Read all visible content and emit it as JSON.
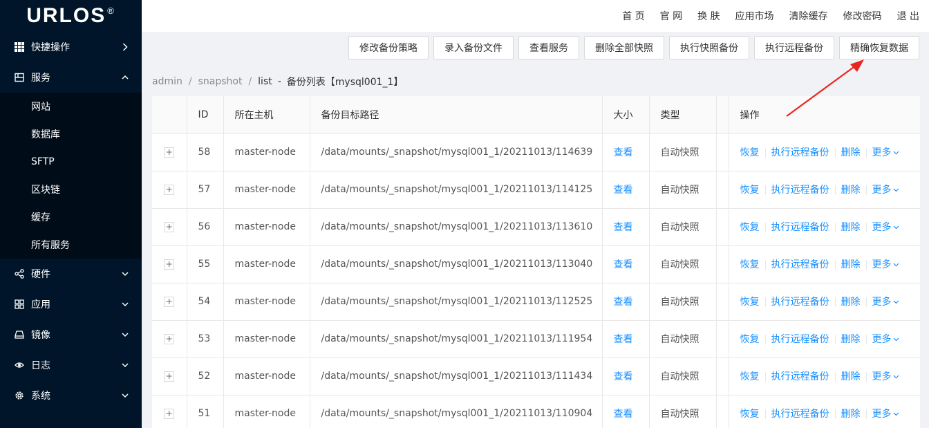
{
  "logo": {
    "text": "URLOS",
    "mark": "®"
  },
  "sidebar": {
    "quick": {
      "label": "快捷操作",
      "icon": "grid-icon"
    },
    "services": {
      "label": "服务",
      "icon": "server-icon",
      "items": [
        "网站",
        "数据库",
        "SFTP",
        "区块链",
        "缓存",
        "所有服务"
      ]
    },
    "bottom": [
      {
        "label": "硬件",
        "icon": "share-icon"
      },
      {
        "label": "应用",
        "icon": "apps-icon"
      },
      {
        "label": "镜像",
        "icon": "drive-icon"
      },
      {
        "label": "日志",
        "icon": "eye-icon"
      },
      {
        "label": "系统",
        "icon": "gear-icon"
      }
    ]
  },
  "header": {
    "links": [
      "首 页",
      "官 网",
      "换 肤",
      "应用市场",
      "清除缓存",
      "修改密码",
      "退 出"
    ]
  },
  "toolbar": {
    "buttons": [
      "修改备份策略",
      "录入备份文件",
      "查看服务",
      "删除全部快照",
      "执行快照备份",
      "执行远程备份",
      "精确恢复数据"
    ]
  },
  "breadcrumb": {
    "parts": [
      "admin",
      "snapshot",
      "list"
    ],
    "dash": "-",
    "current": "备份列表【mysql001_1】"
  },
  "table": {
    "headers": {
      "id": "ID",
      "host": "所在主机",
      "path": "备份目标路径",
      "size": "大小",
      "type": "类型",
      "op": "操作"
    },
    "expand_label": "+",
    "ops": {
      "restore": "恢复",
      "remote": "执行远程备份",
      "delete": "删除",
      "more": "更多"
    },
    "rows": [
      {
        "id": "58",
        "host": "master-node",
        "path": "/data/mounts/_snapshot/mysql001_1/20211013/114639",
        "size": "查看",
        "type": "自动快照"
      },
      {
        "id": "57",
        "host": "master-node",
        "path": "/data/mounts/_snapshot/mysql001_1/20211013/114125",
        "size": "查看",
        "type": "自动快照"
      },
      {
        "id": "56",
        "host": "master-node",
        "path": "/data/mounts/_snapshot/mysql001_1/20211013/113610",
        "size": "查看",
        "type": "自动快照"
      },
      {
        "id": "55",
        "host": "master-node",
        "path": "/data/mounts/_snapshot/mysql001_1/20211013/113040",
        "size": "查看",
        "type": "自动快照"
      },
      {
        "id": "54",
        "host": "master-node",
        "path": "/data/mounts/_snapshot/mysql001_1/20211013/112525",
        "size": "查看",
        "type": "自动快照"
      },
      {
        "id": "53",
        "host": "master-node",
        "path": "/data/mounts/_snapshot/mysql001_1/20211013/111954",
        "size": "查看",
        "type": "自动快照"
      },
      {
        "id": "52",
        "host": "master-node",
        "path": "/data/mounts/_snapshot/mysql001_1/20211013/111434",
        "size": "查看",
        "type": "自动快照"
      },
      {
        "id": "51",
        "host": "master-node",
        "path": "/data/mounts/_snapshot/mysql001_1/20211013/110904",
        "size": "查看",
        "type": "自动快照"
      }
    ]
  },
  "colors": {
    "sidebar": "#001529",
    "submenu": "#000c17",
    "link": "#1890ff",
    "arrow": "#e8261f"
  }
}
